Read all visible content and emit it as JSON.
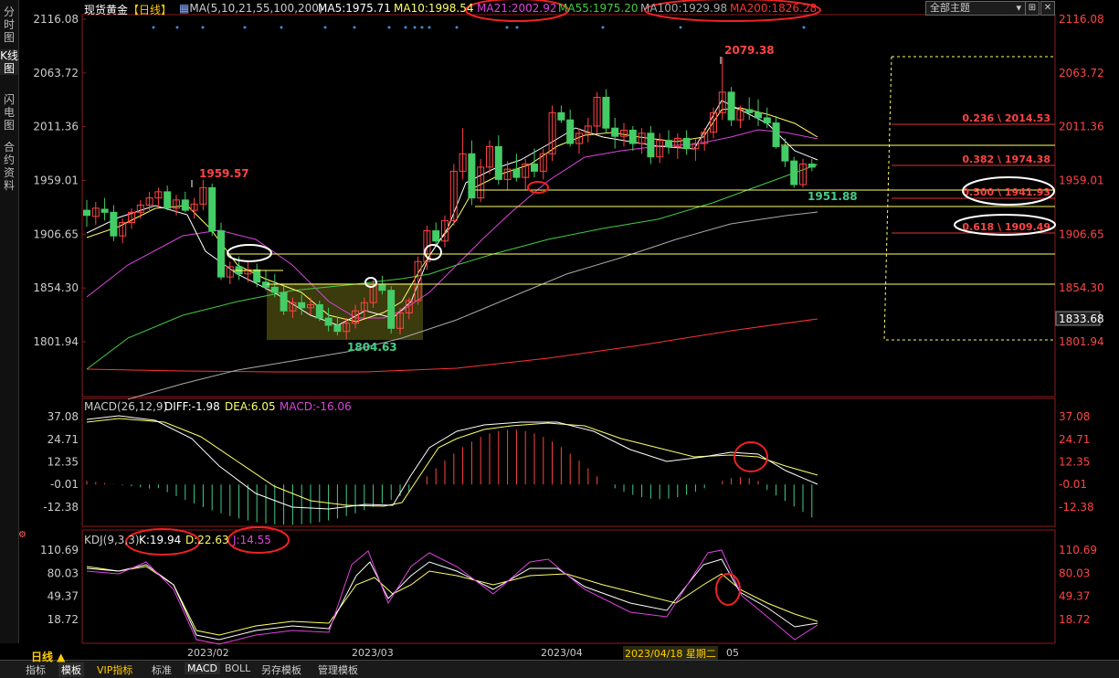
{
  "left_tabs": [
    {
      "label": "分时图"
    },
    {
      "label": "K线图"
    },
    {
      "label": "闪电图"
    },
    {
      "label": "合约资料"
    }
  ],
  "header": {
    "symbol": "现货黄金",
    "period": "【日线】",
    "ma_label": "MA(5,10,21,55,100,200)",
    "ma5": "MA5:1975.71",
    "ma10": "MA10:1998.54",
    "ma21": "MA21:2002.92",
    "ma55": "MA55:1975.20",
    "ma100": "MA100:1929.98",
    "ma200": "MA200:1826.28",
    "theme_select": "全部主题",
    "colors": {
      "ma5": "#ffffff",
      "ma10": "#ffff66",
      "ma21": "#dd44dd",
      "ma55": "#44cc44",
      "ma100": "#aaaaaa",
      "ma200": "#ff3333"
    }
  },
  "macd_header": {
    "label": "MACD(26,12,9)",
    "diff": "DIFF:-1.98",
    "dea": "DEA:6.05",
    "macd": "MACD:-16.06"
  },
  "kdj_header": {
    "label": "KDJ(9,3,3)",
    "k": "K:19.94",
    "d": "D:22.63",
    "j": "J:14.55"
  },
  "price_axis": [
    "2116.08",
    "2063.72",
    "2011.36",
    "1959.01",
    "1906.65",
    "1854.30",
    "1801.94"
  ],
  "current_price": "1833.68",
  "macd_axis": [
    "37.08",
    "24.71",
    "12.35",
    "-0.01",
    "-12.38"
  ],
  "kdj_axis": [
    "110.69",
    "80.03",
    "49.37",
    "18.72"
  ],
  "x_axis": [
    "2023/02",
    "2023/03",
    "2023/04"
  ],
  "x_axis_partial": "05",
  "cursor_date": "2023/04/18 星期二",
  "annotations": {
    "high_1": "1959.57",
    "low_1": "1804.63",
    "high_2": "2079.38",
    "low_2": "1951.88"
  },
  "fibonacci": [
    {
      "label": "0.236 \\ 2014.53"
    },
    {
      "label": "0.382 \\ 1974.38"
    },
    {
      "label": "0.500 \\ 1941.93"
    },
    {
      "label": "0.618 \\ 1909.49"
    }
  ],
  "bottom_tabs": [
    {
      "label": "日线 ▲"
    },
    {
      "label": "指标"
    },
    {
      "label": "模板"
    },
    {
      "label": "VIP指标"
    },
    {
      "label": "标准"
    },
    {
      "label": "MACD"
    },
    {
      "label": "BOLL"
    },
    {
      "label": "另存模板"
    },
    {
      "label": "管理模板"
    }
  ],
  "chart_data": {
    "type": "candlestick",
    "title": "现货黄金 【日线】",
    "ylim": [
      1790,
      2120
    ],
    "x_start": "2023/01/24",
    "candles": [
      {
        "o": 1930,
        "h": 1940,
        "l": 1914,
        "c": 1925
      },
      {
        "o": 1924,
        "h": 1938,
        "l": 1916,
        "c": 1932
      },
      {
        "o": 1931,
        "h": 1942,
        "l": 1920,
        "c": 1928
      },
      {
        "o": 1928,
        "h": 1935,
        "l": 1900,
        "c": 1905
      },
      {
        "o": 1905,
        "h": 1922,
        "l": 1898,
        "c": 1918
      },
      {
        "o": 1918,
        "h": 1932,
        "l": 1912,
        "c": 1928
      },
      {
        "o": 1928,
        "h": 1940,
        "l": 1922,
        "c": 1935
      },
      {
        "o": 1935,
        "h": 1948,
        "l": 1928,
        "c": 1942
      },
      {
        "o": 1942,
        "h": 1952,
        "l": 1932,
        "c": 1948
      },
      {
        "o": 1948,
        "h": 1954,
        "l": 1930,
        "c": 1932
      },
      {
        "o": 1932,
        "h": 1945,
        "l": 1925,
        "c": 1940
      },
      {
        "o": 1940,
        "h": 1948,
        "l": 1928,
        "c": 1930
      },
      {
        "o": 1930,
        "h": 1942,
        "l": 1922,
        "c": 1936
      },
      {
        "o": 1936,
        "h": 1959.57,
        "l": 1930,
        "c": 1952
      },
      {
        "o": 1952,
        "h": 1956,
        "l": 1905,
        "c": 1910
      },
      {
        "o": 1910,
        "h": 1918,
        "l": 1862,
        "c": 1865
      },
      {
        "o": 1865,
        "h": 1880,
        "l": 1858,
        "c": 1875
      },
      {
        "o": 1875,
        "h": 1885,
        "l": 1862,
        "c": 1868
      },
      {
        "o": 1868,
        "h": 1880,
        "l": 1860,
        "c": 1872
      },
      {
        "o": 1872,
        "h": 1878,
        "l": 1855,
        "c": 1860
      },
      {
        "o": 1860,
        "h": 1872,
        "l": 1852,
        "c": 1855
      },
      {
        "o": 1855,
        "h": 1868,
        "l": 1845,
        "c": 1850
      },
      {
        "o": 1850,
        "h": 1858,
        "l": 1828,
        "c": 1832
      },
      {
        "o": 1832,
        "h": 1845,
        "l": 1825,
        "c": 1840
      },
      {
        "o": 1840,
        "h": 1848,
        "l": 1828,
        "c": 1835
      },
      {
        "o": 1835,
        "h": 1845,
        "l": 1828,
        "c": 1838
      },
      {
        "o": 1838,
        "h": 1842,
        "l": 1822,
        "c": 1825
      },
      {
        "o": 1825,
        "h": 1835,
        "l": 1812,
        "c": 1818
      },
      {
        "o": 1818,
        "h": 1826,
        "l": 1808,
        "c": 1812
      },
      {
        "o": 1812,
        "h": 1825,
        "l": 1804.63,
        "c": 1820
      },
      {
        "o": 1820,
        "h": 1838,
        "l": 1815,
        "c": 1832
      },
      {
        "o": 1832,
        "h": 1845,
        "l": 1826,
        "c": 1840
      },
      {
        "o": 1840,
        "h": 1862,
        "l": 1835,
        "c": 1858
      },
      {
        "o": 1858,
        "h": 1866,
        "l": 1848,
        "c": 1852
      },
      {
        "o": 1852,
        "h": 1856,
        "l": 1810,
        "c": 1815
      },
      {
        "o": 1815,
        "h": 1835,
        "l": 1809,
        "c": 1830
      },
      {
        "o": 1830,
        "h": 1845,
        "l": 1824,
        "c": 1842
      },
      {
        "o": 1842,
        "h": 1885,
        "l": 1838,
        "c": 1880
      },
      {
        "o": 1880,
        "h": 1915,
        "l": 1872,
        "c": 1910
      },
      {
        "o": 1910,
        "h": 1918,
        "l": 1896,
        "c": 1900
      },
      {
        "o": 1900,
        "h": 1925,
        "l": 1894,
        "c": 1920
      },
      {
        "o": 1920,
        "h": 1975,
        "l": 1915,
        "c": 1968
      },
      {
        "o": 1968,
        "h": 2010,
        "l": 1960,
        "c": 1985
      },
      {
        "o": 1985,
        "h": 1998,
        "l": 1935,
        "c": 1942
      },
      {
        "o": 1942,
        "h": 1980,
        "l": 1938,
        "c": 1972
      },
      {
        "o": 1972,
        "h": 1998,
        "l": 1965,
        "c": 1992
      },
      {
        "o": 1992,
        "h": 2003,
        "l": 1955,
        "c": 1960
      },
      {
        "o": 1960,
        "h": 1978,
        "l": 1950,
        "c": 1970
      },
      {
        "o": 1970,
        "h": 1985,
        "l": 1958,
        "c": 1962
      },
      {
        "o": 1962,
        "h": 1980,
        "l": 1950,
        "c": 1975
      },
      {
        "o": 1975,
        "h": 1990,
        "l": 1962,
        "c": 1968
      },
      {
        "o": 1968,
        "h": 1990,
        "l": 1960,
        "c": 1985
      },
      {
        "o": 1985,
        "h": 2032,
        "l": 1978,
        "c": 2025
      },
      {
        "o": 2025,
        "h": 2032,
        "l": 2015,
        "c": 2018
      },
      {
        "o": 2018,
        "h": 2028,
        "l": 1992,
        "c": 1995
      },
      {
        "o": 1995,
        "h": 2010,
        "l": 1985,
        "c": 2005
      },
      {
        "o": 2005,
        "h": 2020,
        "l": 1996,
        "c": 2012
      },
      {
        "o": 2012,
        "h": 2045,
        "l": 2005,
        "c": 2040
      },
      {
        "o": 2040,
        "h": 2048,
        "l": 2005,
        "c": 2010
      },
      {
        "o": 2010,
        "h": 2020,
        "l": 1990,
        "c": 2002
      },
      {
        "o": 2002,
        "h": 2015,
        "l": 1992,
        "c": 2008
      },
      {
        "o": 2008,
        "h": 2012,
        "l": 1988,
        "c": 1995
      },
      {
        "o": 1995,
        "h": 2010,
        "l": 1985,
        "c": 2005
      },
      {
        "o": 2005,
        "h": 2012,
        "l": 1975,
        "c": 1982
      },
      {
        "o": 1982,
        "h": 2005,
        "l": 1976,
        "c": 1998
      },
      {
        "o": 1998,
        "h": 2008,
        "l": 1985,
        "c": 1992
      },
      {
        "o": 1992,
        "h": 2005,
        "l": 1980,
        "c": 2000
      },
      {
        "o": 2000,
        "h": 2008,
        "l": 1984,
        "c": 1990
      },
      {
        "o": 1990,
        "h": 2000,
        "l": 1978,
        "c": 1995
      },
      {
        "o": 1995,
        "h": 2010,
        "l": 1988,
        "c": 2006
      },
      {
        "o": 2006,
        "h": 2030,
        "l": 2000,
        "c": 2025
      },
      {
        "o": 2025,
        "h": 2079.38,
        "l": 2018,
        "c": 2045
      },
      {
        "o": 2045,
        "h": 2050,
        "l": 2012,
        "c": 2018
      },
      {
        "o": 2018,
        "h": 2032,
        "l": 2010,
        "c": 2028
      },
      {
        "o": 2028,
        "h": 2040,
        "l": 2018,
        "c": 2025
      },
      {
        "o": 2025,
        "h": 2038,
        "l": 2012,
        "c": 2020
      },
      {
        "o": 2020,
        "h": 2030,
        "l": 2010,
        "c": 2015
      },
      {
        "o": 2015,
        "h": 2022,
        "l": 1990,
        "c": 1992
      },
      {
        "o": 1992,
        "h": 2000,
        "l": 1972,
        "c": 1978
      },
      {
        "o": 1978,
        "h": 1982,
        "l": 1951.88,
        "c": 1955
      },
      {
        "o": 1955,
        "h": 1980,
        "l": 1952,
        "c": 1975
      },
      {
        "o": 1975,
        "h": 1980,
        "l": 1968,
        "c": 1972
      }
    ],
    "ma_series": [
      {
        "name": "MA5",
        "value": 1975.71
      },
      {
        "name": "MA10",
        "value": 1998.54
      },
      {
        "name": "MA21",
        "value": 2002.92
      },
      {
        "name": "MA55",
        "value": 1975.2
      },
      {
        "name": "MA100",
        "value": 1929.98
      },
      {
        "name": "MA200",
        "value": 1826.28
      }
    ],
    "macd": {
      "ylim": [
        -22,
        42
      ],
      "diff": -1.98,
      "dea": 6.05,
      "macd": -16.06
    },
    "kdj": {
      "ylim": [
        0,
        115
      ],
      "k": 19.94,
      "d": 22.63,
      "j": 14.55
    }
  }
}
